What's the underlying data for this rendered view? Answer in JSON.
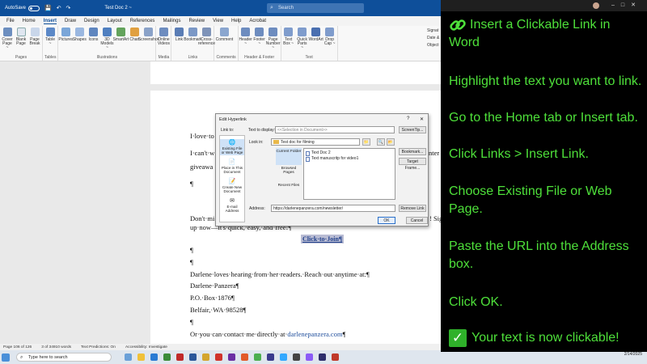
{
  "titlebar": {
    "autosave": "AutoSave",
    "toggle": "Off",
    "doc_title": "Test Doc 2 ~",
    "search_placeholder": "Search"
  },
  "menu": [
    "File",
    "Home",
    "Insert",
    "Draw",
    "Design",
    "Layout",
    "References",
    "Mailings",
    "Review",
    "View",
    "Help",
    "Acrobat"
  ],
  "ribbon": {
    "groups": [
      {
        "label": "Pages",
        "buttons": [
          "Cover Page ~",
          "Blank Page",
          "Page Break"
        ]
      },
      {
        "label": "Tables",
        "buttons": [
          "Table ~"
        ]
      },
      {
        "label": "Illustrations",
        "buttons": [
          "Pictures",
          "Shapes",
          "Icons",
          "3D Models ~",
          "SmartArt",
          "Chart",
          "Screenshot"
        ]
      },
      {
        "label": "Media",
        "buttons": [
          "Online Videos"
        ]
      },
      {
        "label": "Links",
        "buttons": [
          "Link",
          "Bookmark",
          "Cross-reference"
        ]
      },
      {
        "label": "Comments",
        "buttons": [
          "Comment"
        ]
      },
      {
        "label": "Header & Footer",
        "buttons": [
          "Header ~",
          "Footer ~",
          "Page Number ~"
        ]
      },
      {
        "label": "Text",
        "buttons": [
          "Text Box ~",
          "Quick Parts ~",
          "WordArt",
          "Drop Cap ~"
        ]
      }
    ],
    "right_items": [
      "Signat",
      "Date &",
      "Object"
    ]
  },
  "document": {
    "line1": "I·love·to",
    "line2a": "I·can't·w",
    "line2b": "nter",
    "line3": "giveawa",
    "para1": "¶",
    "line_dont": "Don't·mi",
    "line_dont_r": "! Sig",
    "line_signup": "up·now—it's·quick,·easy,·and·free!¶",
    "join_button": "Click·to·Join¶",
    "para2": "¶",
    "para3": "¶",
    "line_darlene": "Darlene·loves·hearing·from·her·readers.·Reach·out·anytime·at:¶",
    "addr1": "Darlene·Panzera¶",
    "addr2": "P.O.·Box·1876¶",
    "addr3": "Belfair,·WA·98528¶",
    "para4": "¶",
    "contact_prefix": "Or·you·can·contact·me·directly·at·",
    "contact_link": "darlenepanzera.com",
    "contact_suffix": "¶"
  },
  "dialog": {
    "title": "Edit Hyperlink",
    "help": "?",
    "close": "✕",
    "link_to_label": "Link to:",
    "text_to_display_label": "Text to display:",
    "text_to_display_value": "<<Selection in Document>>",
    "screentip_button": "ScreenTip...",
    "look_in_label": "Look in:",
    "look_in_value": "Test doc for filming",
    "bookmark_button": "Bookmark...",
    "target_frame_button": "Target Frame...",
    "link_options": [
      "Existing File or Web Page",
      "Place in This Document",
      "Create New Document",
      "E-mail Address"
    ],
    "side_options": [
      "Current Folder",
      "Browsed Pages",
      "Recent Files"
    ],
    "files": [
      "Text Doc 2",
      "Text manuscritp for video1"
    ],
    "address_label": "Address:",
    "address_value": "https://darlenepanzera.com/newsletter/",
    "remove_link_button": "Remove Link",
    "ok_button": "OK",
    "cancel_button": "Cancel"
  },
  "statusbar": {
    "page": "Page 106 of 126",
    "words": "3 of 34910 words",
    "predictions": "Text Predictions: On",
    "accessibility": "Accessibility: Investigate"
  },
  "taskbar": {
    "search_placeholder": "Type here to search",
    "time": "",
    "date": "2/14/2025"
  },
  "tutorial": {
    "title": "Insert a Clickable Link in Word",
    "steps": [
      "Highlight the text you want to link.",
      "Go to the Home tab or Insert tab.",
      "Click Links > Insert Link.",
      "Choose Existing File or Web Page.",
      "Paste the URL into the Address box.",
      "Click OK."
    ],
    "final": "Your text is now clickable!"
  },
  "colors": {
    "word_blue": "#0e4f9a",
    "overlay_green": "#4ee03a",
    "overlay_bg": "#000000",
    "link_blue": "#1f4e9c"
  }
}
